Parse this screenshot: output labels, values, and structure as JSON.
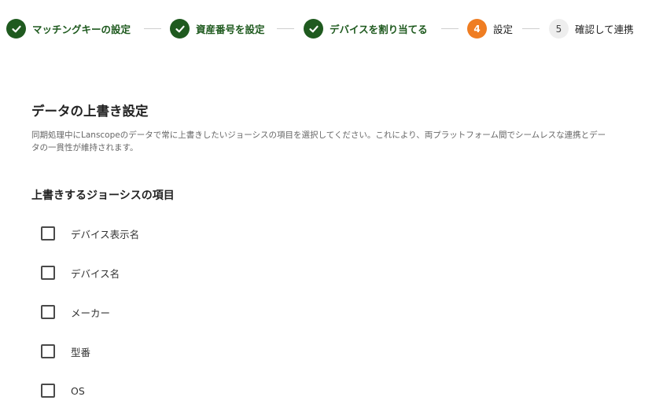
{
  "stepper": {
    "steps": [
      {
        "label": "マッチングキーの設定",
        "status": "done"
      },
      {
        "label": "資産番号を設定",
        "status": "done"
      },
      {
        "label": "デバイスを割り当てる",
        "status": "done"
      },
      {
        "number": "4",
        "label": "設定",
        "status": "current"
      },
      {
        "number": "5",
        "label": "確認して連携",
        "status": "todo"
      }
    ]
  },
  "section": {
    "title": "データの上書き設定",
    "description": "同期処理中にLanscopeのデータで常に上書きしたいジョーシスの項目を選択してください。これにより、両プラットフォーム間でシームレスな連携とデータの一貫性が維持されます。"
  },
  "overwrite": {
    "title": "上書きするジョーシスの項目",
    "items": [
      {
        "label": "デバイス表示名",
        "checked": false
      },
      {
        "label": "デバイス名",
        "checked": false
      },
      {
        "label": "メーカー",
        "checked": false
      },
      {
        "label": "型番",
        "checked": false
      },
      {
        "label": "OS",
        "checked": false
      }
    ]
  },
  "colors": {
    "done": "#1f5a1f",
    "current": "#ef7d22",
    "todo": "#eeeeee"
  }
}
